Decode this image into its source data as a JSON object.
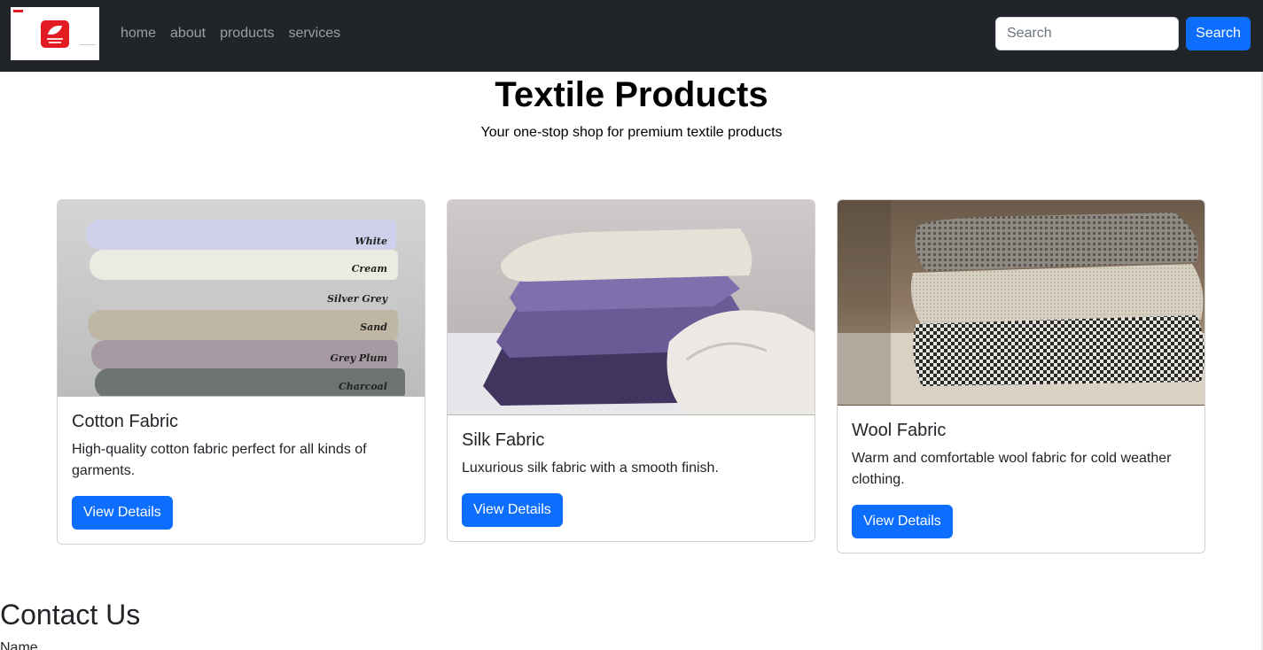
{
  "nav": {
    "links": [
      "home",
      "about",
      "products",
      "services"
    ],
    "search_placeholder": "Search",
    "search_button": "Search"
  },
  "hero": {
    "title": "Textile Products",
    "subtitle": "Your one-stop shop for premium textile products"
  },
  "products": [
    {
      "title": "Cotton Fabric",
      "text": "High-quality cotton fabric perfect for all kinds of garments.",
      "button": "View Details",
      "image_labels": [
        "White",
        "Cream",
        "Silver Grey",
        "Sand",
        "Grey Plum",
        "Charcoal"
      ]
    },
    {
      "title": "Silk Fabric",
      "text": "Luxurious silk fabric with a smooth finish.",
      "button": "View Details"
    },
    {
      "title": "Wool Fabric",
      "text": "Warm and comfortable wool fabric for cold weather clothing.",
      "button": "View Details"
    }
  ],
  "contact": {
    "title": "Contact Us",
    "name_label": "Name"
  },
  "colors": {
    "navbar_bg": "#212529",
    "primary": "#0d6efd",
    "brand_red": "#e31b23"
  }
}
